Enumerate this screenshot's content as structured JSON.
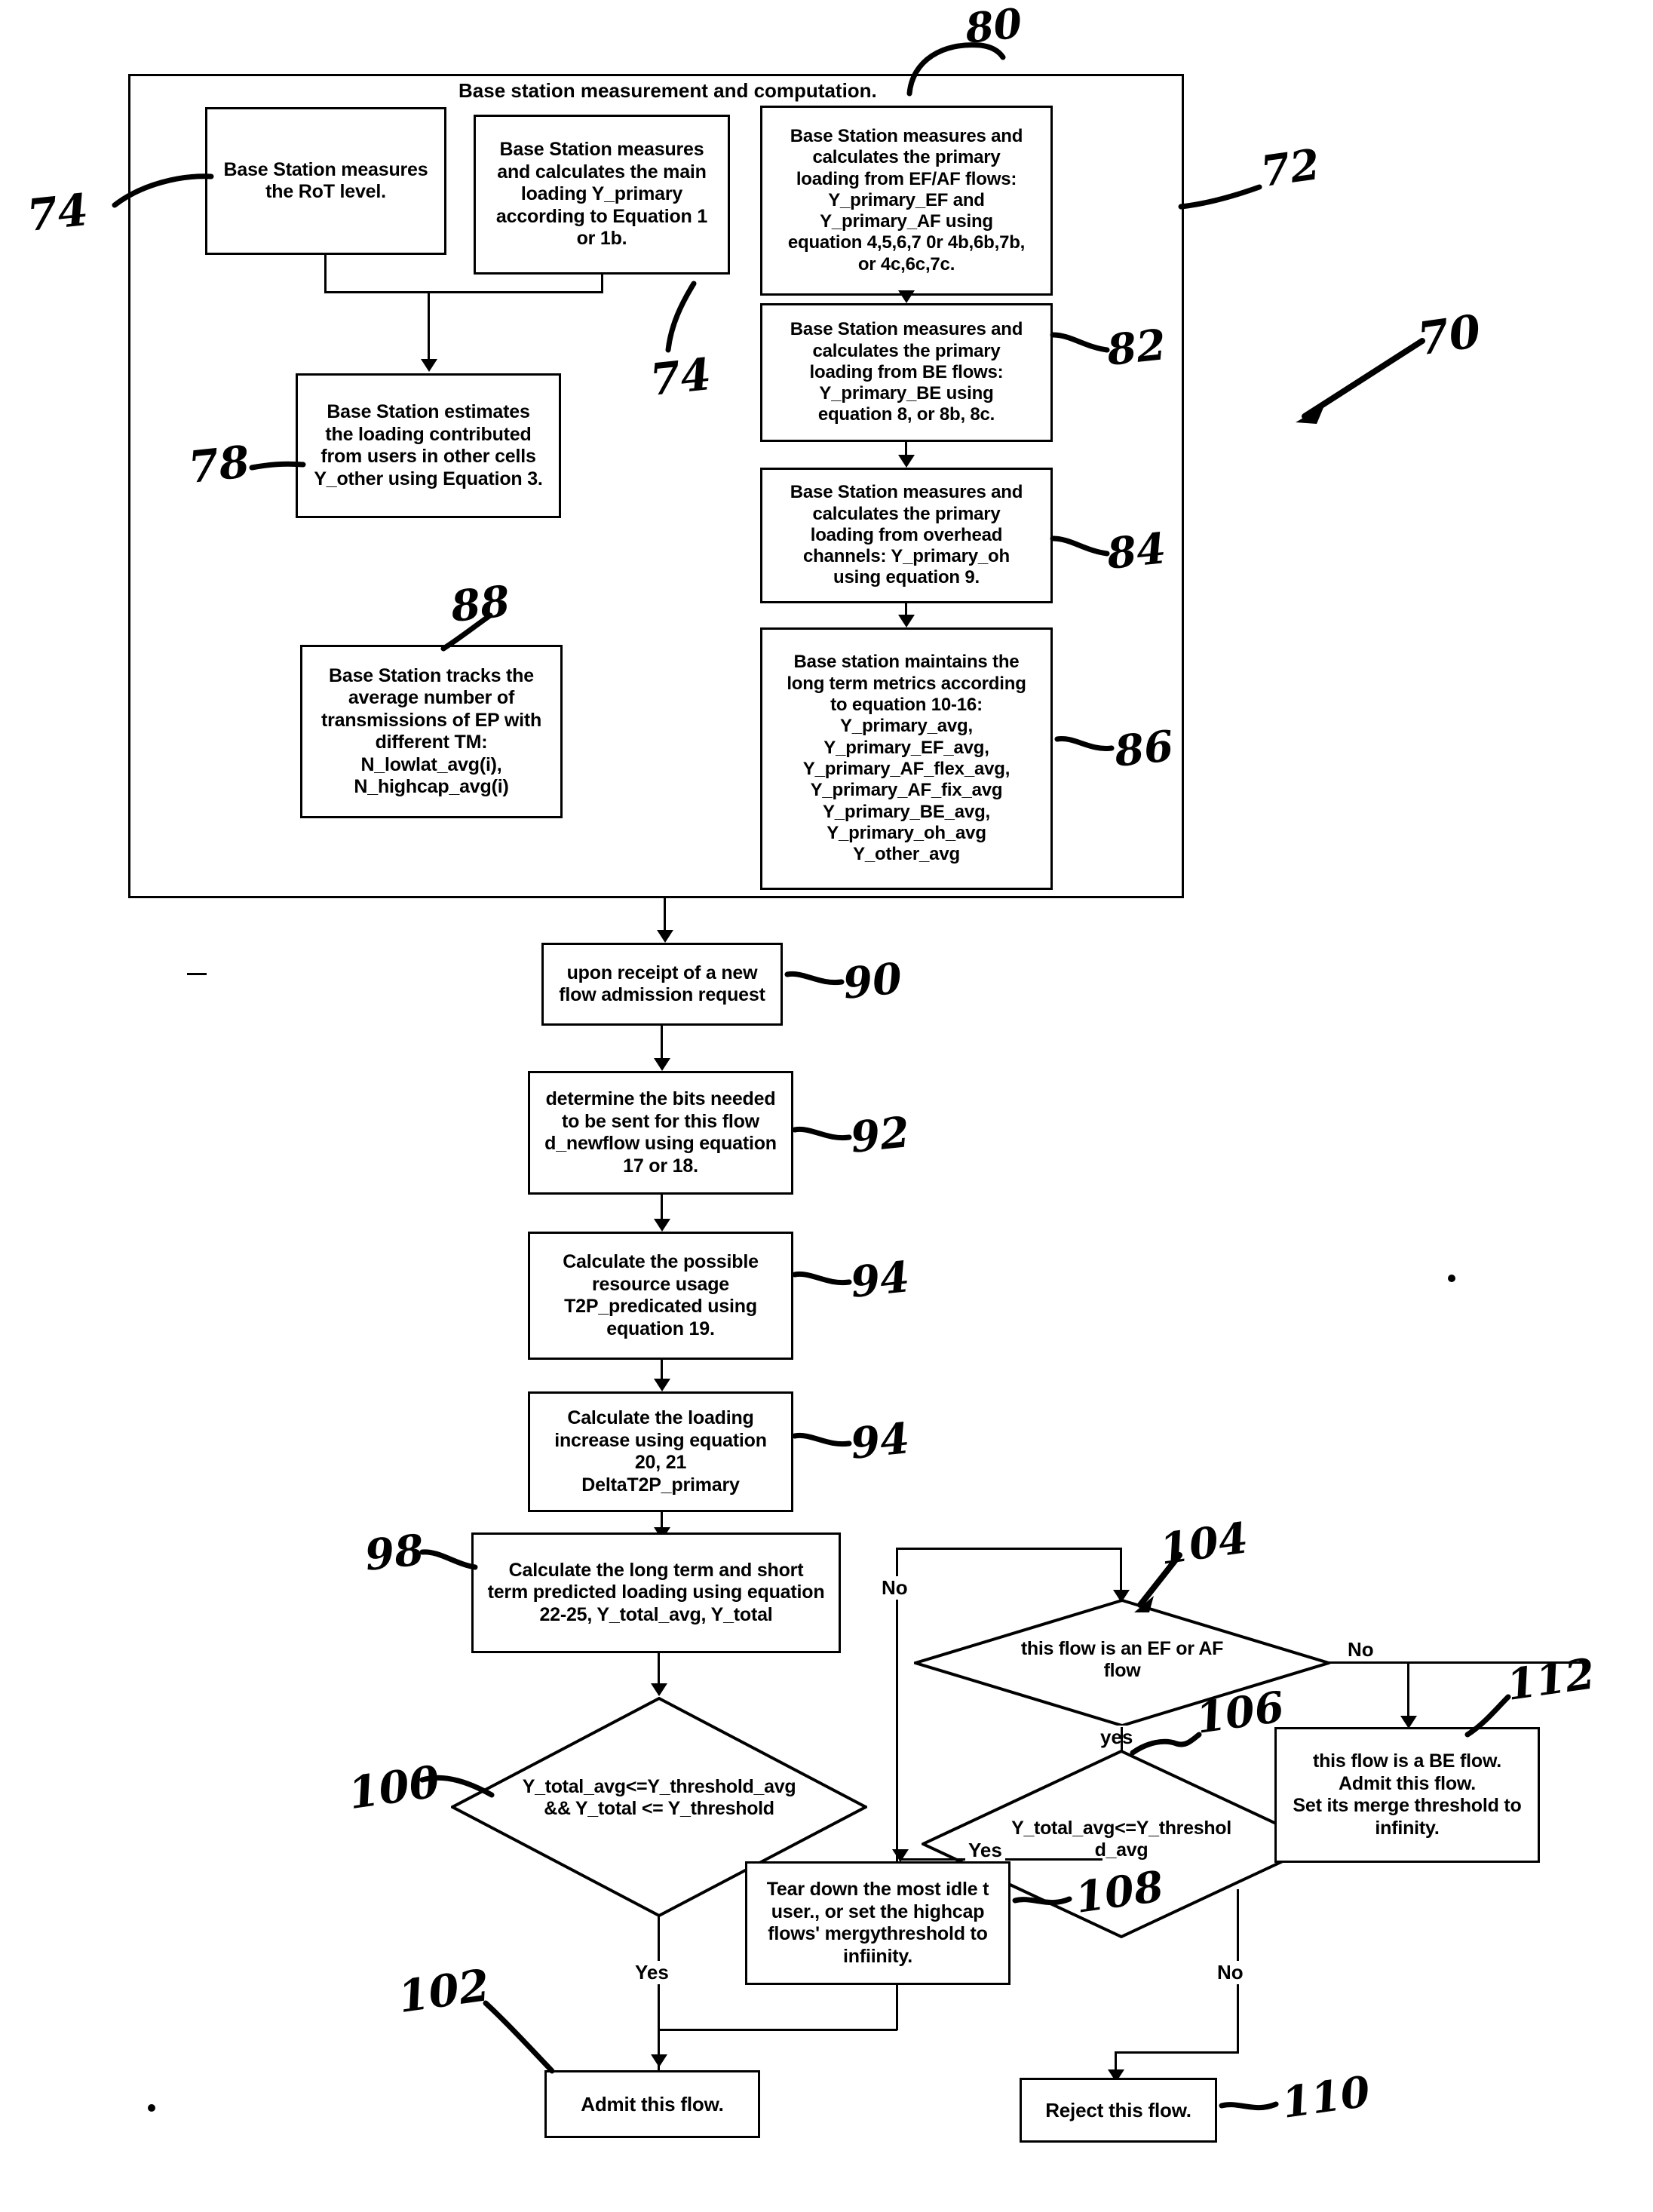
{
  "figure": {
    "id_label": "70",
    "group": {
      "title": "Base station measurement and computation.",
      "ref": "72"
    }
  },
  "boxes": {
    "rot": {
      "ref": "74",
      "text": "Base Station measures\nthe RoT level."
    },
    "primary_main": {
      "ref": "74",
      "text": "Base Station measures\nand calculates the main\nloading Y_primary\naccording to Equation 1\nor 1b."
    },
    "ef_af": {
      "ref": "80",
      "text": "Base Station measures and\ncalculates the primary\nloading from EF/AF flows:\nY_primary_EF and\nY_primary_AF using\nequation  4,5,6,7 0r 4b,6b,7b,\nor 4c,6c,7c."
    },
    "be": {
      "ref": "82",
      "text": "Base Station measures and\ncalculates the primary\nloading from BE flows:\nY_primary_BE using\nequation 8, or 8b, 8c."
    },
    "overhead": {
      "ref": "84",
      "text": "Base Station measures and\ncalculates the primary\nloading from overhead\nchannels: Y_primary_oh\nusing equation 9."
    },
    "long_term": {
      "ref": "86",
      "text": "Base station maintains the\nlong term metrics according\nto equation 10-16:\nY_primary_avg,\nY_primary_EF_avg,\nY_primary_AF_flex_avg,\nY_primary_AF_fix_avg\nY_primary_BE_avg,\nY_primary_oh_avg\nY_other_avg"
    },
    "other_cells": {
      "ref": "78",
      "text": "Base Station estimates\nthe loading contributed\nfrom users in other cells\nY_other using Equation 3."
    },
    "tracks_tm": {
      "ref": "88",
      "text": "Base Station tracks the\naverage number of\ntransmissions of EP with\ndifferent TM:\nN_lowlat_avg(i),\nN_highcap_avg(i)"
    },
    "new_request": {
      "ref": "90",
      "text": "upon receipt of a new\nflow admission request"
    },
    "bits_needed": {
      "ref": "92",
      "text": "determine the bits needed\nto be sent for this flow\nd_newflow using equation\n17 or 18."
    },
    "resource_usage": {
      "ref": "94",
      "text": "Calculate the possible\nresource usage\nT2P_predicated using\nequation 19."
    },
    "loading_increase": {
      "ref": "94",
      "text": "Calculate the loading\nincrease using equation\n20, 21\nDeltaT2P_primary"
    },
    "predicted_loading": {
      "ref": "98",
      "text": "Calculate the long term and short\nterm predicted loading using equation\n22-25, Y_total_avg, Y_total"
    },
    "tear_down": {
      "ref": "108",
      "text": "Tear down the most idle t\nuser., or set the highcap\nflows' mergythreshold to\ninfiinity."
    },
    "be_flow": {
      "ref": "112",
      "text": "this flow is a BE flow.\nAdmit this flow.\nSet its merge threshold to\ninfinity."
    },
    "admit": {
      "ref": "102",
      "text": "Admit this flow."
    },
    "reject": {
      "ref": "110",
      "text": "Reject this flow."
    }
  },
  "decisions": {
    "threshold_both": {
      "ref": "100",
      "text": "Y_total_avg<=Y_threshold_avg\n&& Y_total <= Y_threshold"
    },
    "is_ef_af": {
      "ref": "104",
      "text": "this flow is an EF or AF\nflow"
    },
    "threshold_avg": {
      "ref": "106",
      "text": "Y_total_avg<=Y_threshol\nd_avg"
    }
  },
  "edge_labels": {
    "no_left_of_efaf": "No",
    "yes_under_efaf": "yes",
    "no_right_of_efaf": "No",
    "yes_to_teardown": "Yes",
    "yes_admit": "Yes",
    "no_reject": "No"
  }
}
